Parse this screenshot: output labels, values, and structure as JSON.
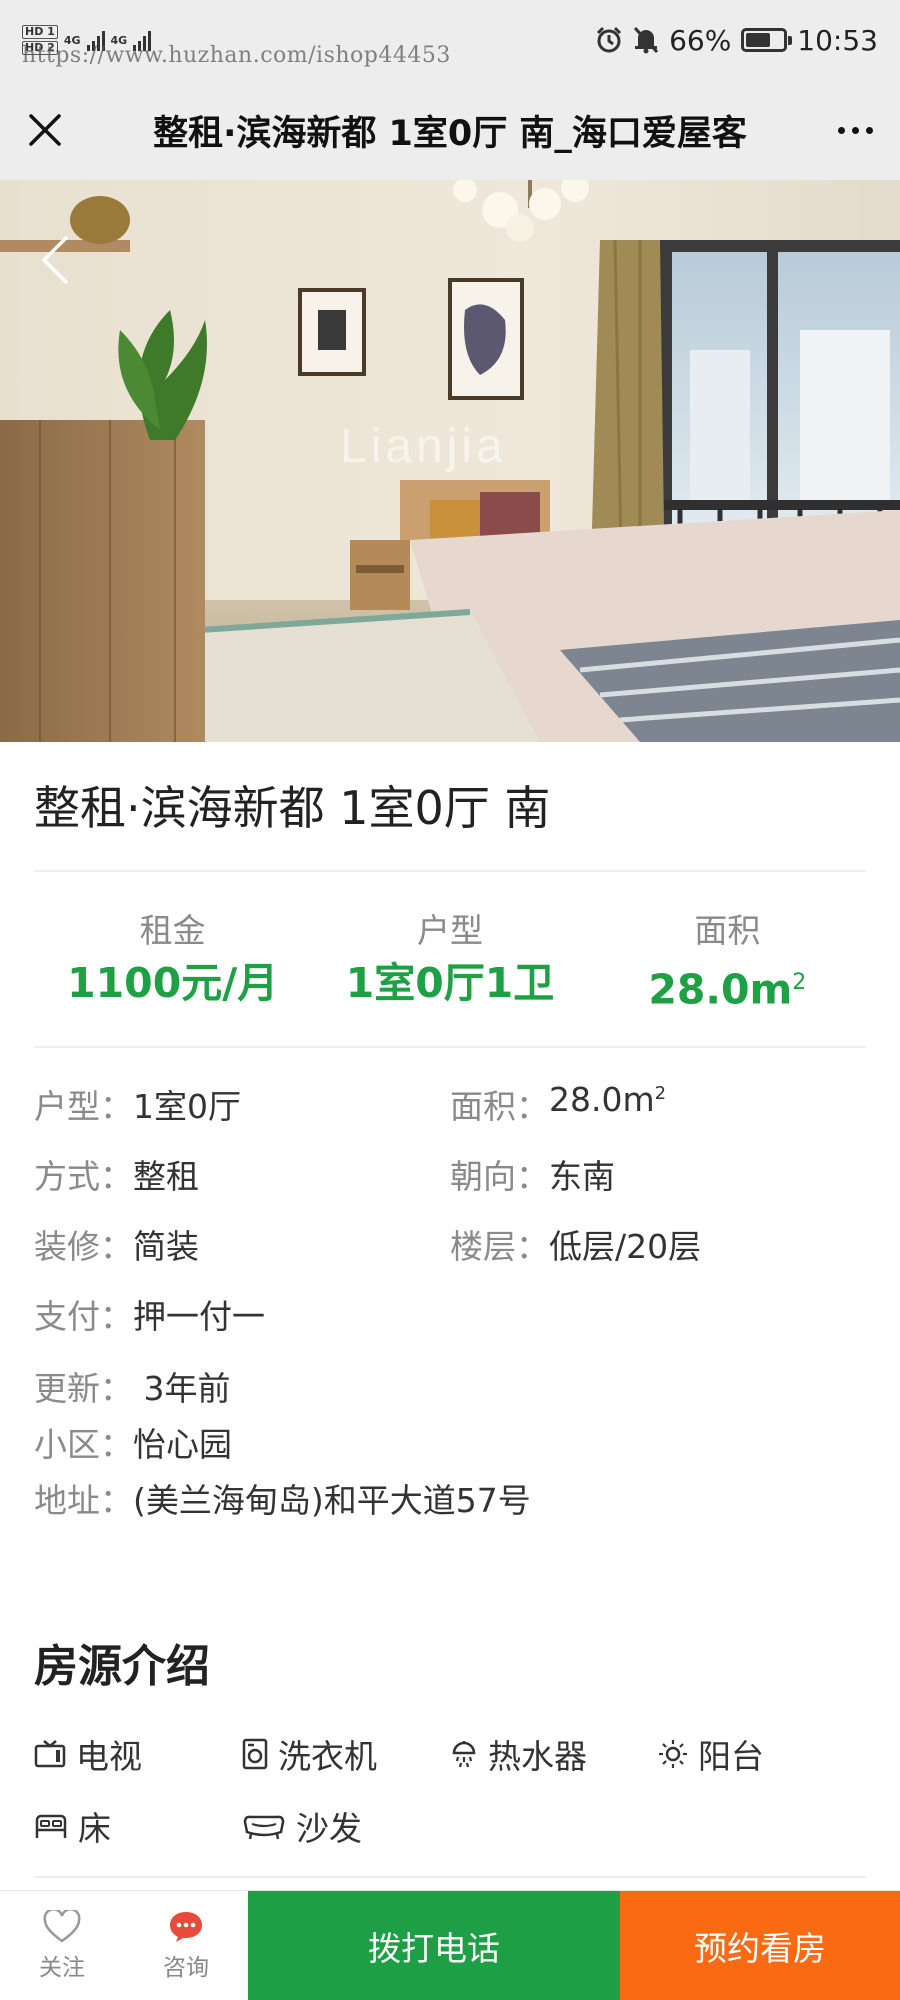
{
  "status_bar": {
    "hd1": "HD 1",
    "hd2": "HD 2",
    "network1": "4G",
    "network2": "4G",
    "watermark": "https://www.huzhan.com/ishop44453",
    "battery_percent": "66%",
    "battery_level": 0.66,
    "time": "10:53"
  },
  "nav": {
    "title": "整租·滨海新都 1室0厅 南_海口爱屋客"
  },
  "hero": {
    "image_watermark": "Lianjia",
    "icons": {
      "back": "chevron-left-icon"
    }
  },
  "listing": {
    "title": "整租·滨海新都 1室0厅 南"
  },
  "stats": [
    {
      "label": "租金",
      "value": "1100元/月",
      "sup": ""
    },
    {
      "label": "户型",
      "value": "1室0厅1卫",
      "sup": ""
    },
    {
      "label": "面积",
      "value": "28.0m",
      "sup": "2"
    }
  ],
  "details": {
    "layout": {
      "key": "户型：",
      "value": "1室0厅"
    },
    "area": {
      "key": "面积：",
      "value": "28.0m",
      "sup": "2"
    },
    "rent_type": {
      "key": "方式：",
      "value": "整租"
    },
    "orientation": {
      "key": "朝向：",
      "value": "东南"
    },
    "decoration": {
      "key": "装修：",
      "value": "简装"
    },
    "floor": {
      "key": "楼层：",
      "value": "低层/20层"
    },
    "payment": {
      "key": "支付：",
      "value": "押一付一"
    },
    "updated": {
      "key": "更新：",
      "value": " 3年前"
    },
    "community": {
      "key": "小区：",
      "value": "怡心园"
    },
    "address": {
      "key": "地址：",
      "value": "(美兰海甸岛)和平大道57号"
    }
  },
  "intro": {
    "title": "房源介绍",
    "amenities": [
      {
        "label": "电视",
        "icon": "tv-icon"
      },
      {
        "label": "洗衣机",
        "icon": "washing-machine-icon"
      },
      {
        "label": "热水器",
        "icon": "water-heater-icon"
      },
      {
        "label": "阳台",
        "icon": "balcony-sun-icon"
      },
      {
        "label": "床",
        "icon": "bed-icon"
      },
      {
        "label": "沙发",
        "icon": "sofa-icon"
      }
    ]
  },
  "bottom_bar": {
    "follow": "关注",
    "consult": "咨询",
    "call": "拨打电话",
    "book": "预约看房"
  },
  "colors": {
    "accent_green": "#1ea045",
    "call_button": "#1e9f45",
    "book_button": "#fa6a12",
    "nav_background": "#ededed"
  }
}
